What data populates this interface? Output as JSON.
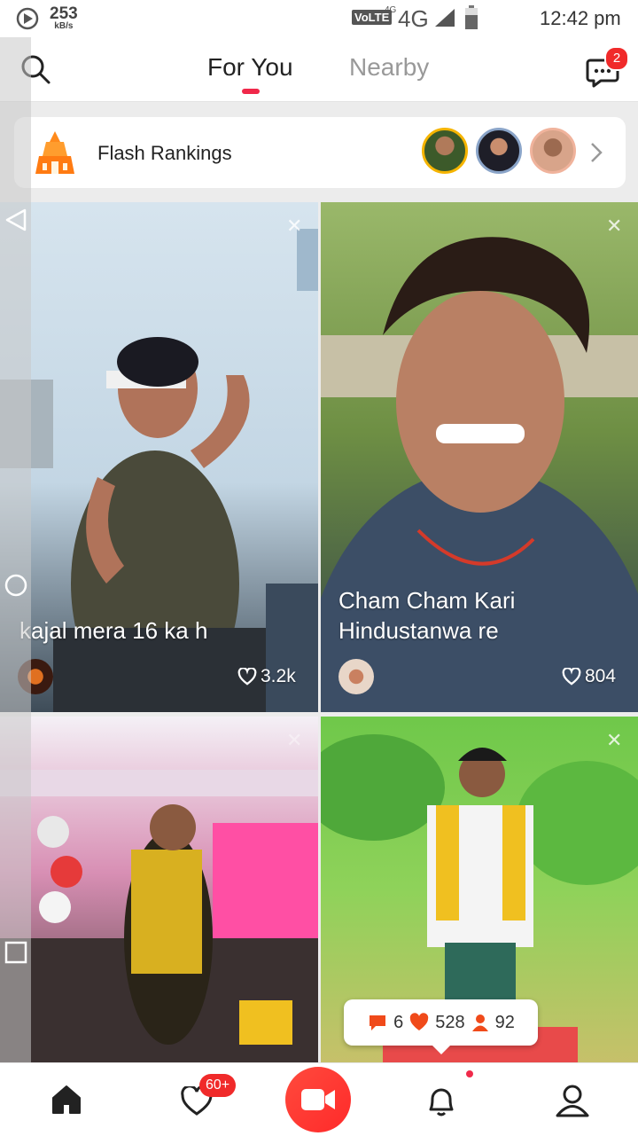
{
  "status_bar": {
    "speed_value": "253",
    "speed_unit": "kB/s",
    "volte": "VoLTE",
    "net_sup": "4G",
    "network": "4G",
    "time": "12:42 pm"
  },
  "header": {
    "tabs": [
      {
        "label": "For You",
        "active": true
      },
      {
        "label": "Nearby",
        "active": false
      }
    ],
    "message_badge": "2",
    "accent_color": "#f0284a"
  },
  "flash_rankings": {
    "title": "Flash Rankings"
  },
  "feed": [
    {
      "caption": "kajal mera 16 ka h",
      "likes": "3.2k"
    },
    {
      "caption": "Cham Cham Kari Hindustanwa re",
      "likes": "804"
    },
    {
      "caption": "",
      "likes": ""
    },
    {
      "caption": "",
      "likes": ""
    }
  ],
  "popup_stats": {
    "comments": "6",
    "likes": "528",
    "followers": "92"
  },
  "bottom_nav": {
    "likes_badge": "60+",
    "items": [
      "home-icon",
      "heart-icon",
      "record-video-icon",
      "bell-icon",
      "profile-icon"
    ]
  }
}
